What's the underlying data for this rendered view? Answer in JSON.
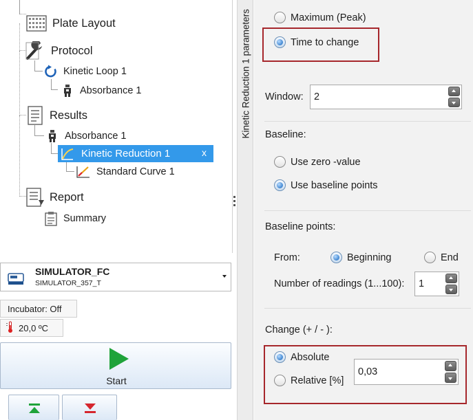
{
  "tree": {
    "plate_layout": "Plate Layout",
    "protocol": "Protocol",
    "kinetic_loop": "Kinetic Loop 1",
    "absorbance_protocol": "Absorbance 1",
    "results": "Results",
    "absorbance_results": "Absorbance 1",
    "kinetic_reduction": "Kinetic Reduction 1",
    "kinetic_reduction_close": "x",
    "standard_curve": "Standard Curve 1",
    "report": "Report",
    "summary": "Summary"
  },
  "instrument": {
    "device_name": "SIMULATOR_FC",
    "device_id": "SIMULATOR_357_T",
    "incubator": "Incubator: Off",
    "temperature": "20,0 ºC",
    "start_label": "Start"
  },
  "vertical_tab": {
    "label": "Kinetic Reduction 1 parameters"
  },
  "params": {
    "mode_options": {
      "maximum": "Maximum (Peak)",
      "time_to_change": "Time to change",
      "selected": "time_to_change"
    },
    "window_label": "Window:",
    "window_value": "2",
    "baseline_label": "Baseline:",
    "baseline_options": {
      "zero": "Use zero -value",
      "points": "Use baseline points",
      "selected": "points"
    },
    "baseline_points_label": "Baseline points:",
    "from_label": "From:",
    "from_options": {
      "beginning": "Beginning",
      "end": "End",
      "selected": "beginning"
    },
    "readings_label": "Number of readings (1...100):",
    "readings_value": "1",
    "change_label": "Change (+ / - ):",
    "change_options": {
      "absolute": "Absolute",
      "relative": "Relative [%]",
      "selected": "absolute"
    },
    "change_value": "0,03"
  },
  "colors": {
    "highlight_box": "#a6262b",
    "selection": "#3399ea",
    "start_green": "#1fa33a"
  }
}
